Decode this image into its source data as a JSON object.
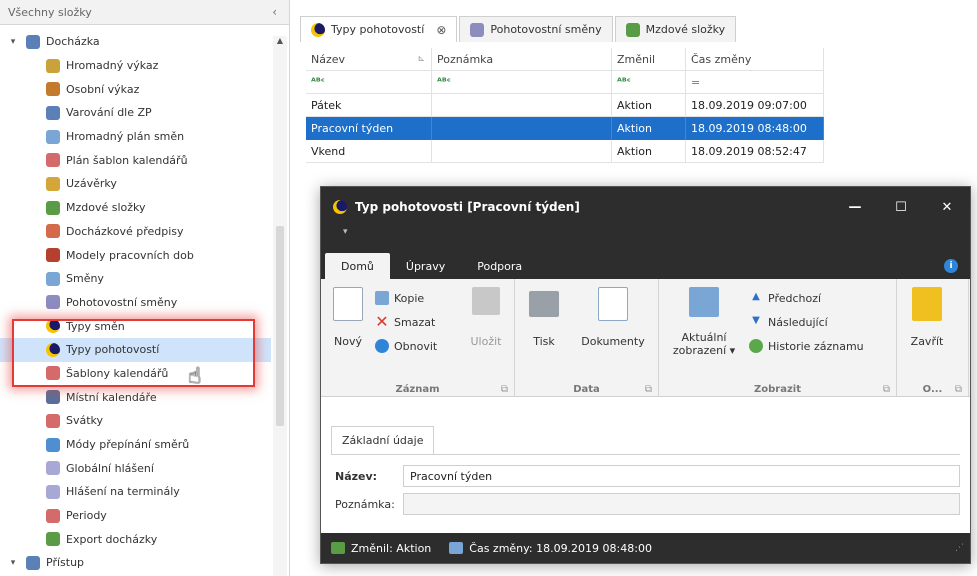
{
  "left_panel": {
    "title": "Všechny složky",
    "collapse_glyph": "‹",
    "tree": [
      {
        "label": "Docházka",
        "level": 0,
        "expander": "▾",
        "icon": "folder-people-icon",
        "color": "#5b7fb7"
      },
      {
        "label": "Hromadný výkaz",
        "level": 1,
        "icon": "report-icon",
        "color": "#c9a23a"
      },
      {
        "label": "Osobní výkaz",
        "level": 1,
        "icon": "person-icon",
        "color": "#c47a2c"
      },
      {
        "label": "Varování dle ZP",
        "level": 1,
        "icon": "warning-icon",
        "color": "#5b7fb7"
      },
      {
        "label": "Hromadný plán směn",
        "level": 1,
        "icon": "plan-icon",
        "color": "#7aa6d6"
      },
      {
        "label": "Plán šablon kalendářů",
        "level": 1,
        "icon": "calendar-plan-icon",
        "color": "#d46a6a"
      },
      {
        "label": "Uzávěrky",
        "level": 1,
        "icon": "lock-icon",
        "color": "#d4a637"
      },
      {
        "label": "Mzdové složky",
        "level": 1,
        "icon": "wage-icon",
        "color": "#5a9c45"
      },
      {
        "label": "Docházkové předpisy",
        "level": 1,
        "icon": "rules-icon",
        "color": "#d46a4a"
      },
      {
        "label": "Modely pracovních dob",
        "level": 1,
        "icon": "model-icon",
        "color": "#b5402f"
      },
      {
        "label": "Směny",
        "level": 1,
        "icon": "shift-icon",
        "color": "#7aa6d6"
      },
      {
        "label": "Pohotovostní směny",
        "level": 1,
        "icon": "standby-shift-icon",
        "color": "#8c8cbf"
      },
      {
        "label": "Typy směn",
        "level": 1,
        "icon": "moon-icon",
        "color": "#1a1a66"
      },
      {
        "label": "Typy pohotovostí",
        "level": 1,
        "icon": "moon-icon",
        "color": "#1a1a66",
        "selected": true
      },
      {
        "label": "Šablony kalendářů",
        "level": 1,
        "icon": "calendar-template-icon",
        "color": "#d46a6a"
      },
      {
        "label": "Místní kalendáře",
        "level": 1,
        "icon": "local-calendar-icon",
        "color": "#5b6f99"
      },
      {
        "label": "Svátky",
        "level": 1,
        "icon": "holiday-icon",
        "color": "#d46a6a"
      },
      {
        "label": "Módy přepínání směrů",
        "level": 1,
        "icon": "direction-icon",
        "color": "#4f8fd1"
      },
      {
        "label": "Globální hlášení",
        "level": 1,
        "icon": "message-icon",
        "color": "#a8a8d6"
      },
      {
        "label": "Hlášení na terminály",
        "level": 1,
        "icon": "terminal-message-icon",
        "color": "#a8a8d6"
      },
      {
        "label": "Periody",
        "level": 1,
        "icon": "period-icon",
        "color": "#d46a6a"
      },
      {
        "label": "Export docházky",
        "level": 1,
        "icon": "export-icon",
        "color": "#5a9c45"
      },
      {
        "label": "Přístup",
        "level": 0,
        "expander": "▾",
        "icon": "access-icon",
        "color": "#5b7fb7"
      }
    ]
  },
  "tabs": [
    {
      "label": "Typy pohotovostí",
      "active": true,
      "icon": "moon-icon",
      "close": "⊗"
    },
    {
      "label": "Pohotovostní směny",
      "active": false,
      "icon": "standby-shift-icon"
    },
    {
      "label": "Mzdové složky",
      "active": false,
      "icon": "wage-icon"
    }
  ],
  "grid": {
    "columns": [
      "Název",
      "Poznámka",
      "Změnil",
      "Čas změny"
    ],
    "filter_row": [
      "ᴬᴮᶜ",
      "ᴬᴮᶜ",
      "ᴬᴮᶜ",
      "="
    ],
    "rows": [
      {
        "cells": [
          "Pátek",
          "",
          "Aktion",
          "18.09.2019 09:07:00"
        ],
        "selected": false
      },
      {
        "cells": [
          "Pracovní týden",
          "",
          "Aktion",
          "18.09.2019 08:48:00"
        ],
        "selected": true
      },
      {
        "cells": [
          "Vkend",
          "",
          "Aktion",
          "18.09.2019 08:52:47"
        ],
        "selected": false
      }
    ]
  },
  "dialog": {
    "title": "Typ pohotovosti [Pracovní týden]",
    "minimize": "—",
    "maximize": "☐",
    "close": "✕",
    "qat_glyph": "▾",
    "ribbon_tabs": [
      "Domů",
      "Úpravy",
      "Podpora"
    ],
    "help_glyph": "i",
    "groups": {
      "zaznam": {
        "caption": "Záznam",
        "new": "Nový",
        "copy": "Kopie",
        "delete": "Smazat",
        "refresh": "Obnovit",
        "save": "Uložit"
      },
      "data": {
        "caption": "Data",
        "print": "Tisk",
        "documents": "Dokumenty"
      },
      "zobrazit": {
        "caption": "Zobrazit",
        "current_view": "Aktuální zobrazení ▾",
        "previous": "Předchozí",
        "next": "Následující",
        "history": "Historie záznamu"
      },
      "close_group": {
        "caption": "O...",
        "close": "Zavřít"
      }
    },
    "form": {
      "tab_label": "Základní údaje",
      "name_label": "Název:",
      "name_value": "Pracovní týden",
      "note_label": "Poznámka:",
      "note_value": ""
    },
    "status": {
      "changed_by": "Změnil: Aktion",
      "changed_time": "Čas změny: 18.09.2019 08:48:00",
      "grip": "⋰"
    }
  }
}
